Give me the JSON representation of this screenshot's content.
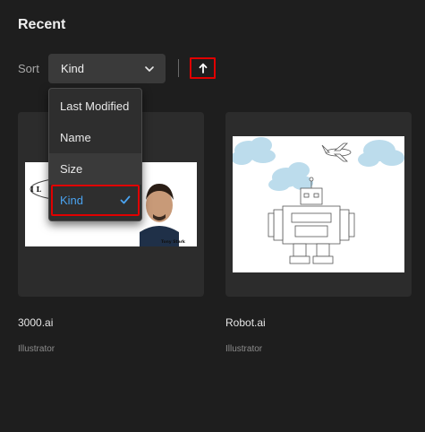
{
  "header": {
    "title": "Recent"
  },
  "sort": {
    "label": "Sort",
    "selected": "Kind",
    "direction_icon": "arrow-up-icon",
    "options": [
      {
        "label": "Last Modified",
        "selected": false
      },
      {
        "label": "Name",
        "selected": false
      },
      {
        "label": "Size",
        "selected": false
      },
      {
        "label": "Kind",
        "selected": true
      }
    ]
  },
  "files": [
    {
      "name": "3000.ai",
      "app": "Illustrator",
      "thumbnail": "iron-man-portrait-thumbnail",
      "thumbnail_text": "Tony Stark"
    },
    {
      "name": "Robot.ai",
      "app": "Illustrator",
      "thumbnail": "robot-clouds-airplane-thumbnail"
    }
  ],
  "colors": {
    "background": "#1e1e1e",
    "card": "#2c2c2c",
    "accent": "#4aa3f0",
    "highlight_outline": "#e00000"
  }
}
